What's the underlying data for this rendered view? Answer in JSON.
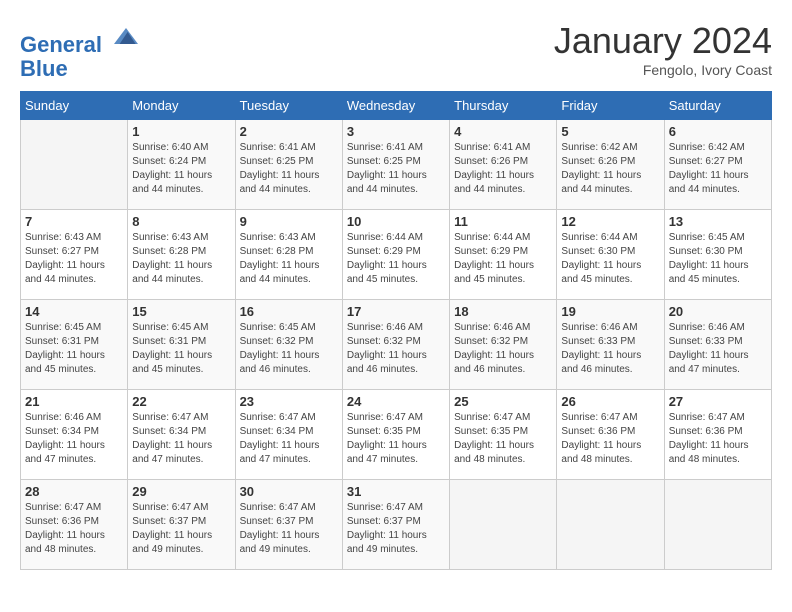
{
  "header": {
    "logo_line1": "General",
    "logo_line2": "Blue",
    "month": "January 2024",
    "location": "Fengolo, Ivory Coast"
  },
  "weekdays": [
    "Sunday",
    "Monday",
    "Tuesday",
    "Wednesday",
    "Thursday",
    "Friday",
    "Saturday"
  ],
  "weeks": [
    [
      {
        "day": "",
        "sunrise": "",
        "sunset": "",
        "daylight": ""
      },
      {
        "day": "1",
        "sunrise": "Sunrise: 6:40 AM",
        "sunset": "Sunset: 6:24 PM",
        "daylight": "Daylight: 11 hours and 44 minutes."
      },
      {
        "day": "2",
        "sunrise": "Sunrise: 6:41 AM",
        "sunset": "Sunset: 6:25 PM",
        "daylight": "Daylight: 11 hours and 44 minutes."
      },
      {
        "day": "3",
        "sunrise": "Sunrise: 6:41 AM",
        "sunset": "Sunset: 6:25 PM",
        "daylight": "Daylight: 11 hours and 44 minutes."
      },
      {
        "day": "4",
        "sunrise": "Sunrise: 6:41 AM",
        "sunset": "Sunset: 6:26 PM",
        "daylight": "Daylight: 11 hours and 44 minutes."
      },
      {
        "day": "5",
        "sunrise": "Sunrise: 6:42 AM",
        "sunset": "Sunset: 6:26 PM",
        "daylight": "Daylight: 11 hours and 44 minutes."
      },
      {
        "day": "6",
        "sunrise": "Sunrise: 6:42 AM",
        "sunset": "Sunset: 6:27 PM",
        "daylight": "Daylight: 11 hours and 44 minutes."
      }
    ],
    [
      {
        "day": "7",
        "sunrise": "Sunrise: 6:43 AM",
        "sunset": "Sunset: 6:27 PM",
        "daylight": "Daylight: 11 hours and 44 minutes."
      },
      {
        "day": "8",
        "sunrise": "Sunrise: 6:43 AM",
        "sunset": "Sunset: 6:28 PM",
        "daylight": "Daylight: 11 hours and 44 minutes."
      },
      {
        "day": "9",
        "sunrise": "Sunrise: 6:43 AM",
        "sunset": "Sunset: 6:28 PM",
        "daylight": "Daylight: 11 hours and 44 minutes."
      },
      {
        "day": "10",
        "sunrise": "Sunrise: 6:44 AM",
        "sunset": "Sunset: 6:29 PM",
        "daylight": "Daylight: 11 hours and 45 minutes."
      },
      {
        "day": "11",
        "sunrise": "Sunrise: 6:44 AM",
        "sunset": "Sunset: 6:29 PM",
        "daylight": "Daylight: 11 hours and 45 minutes."
      },
      {
        "day": "12",
        "sunrise": "Sunrise: 6:44 AM",
        "sunset": "Sunset: 6:30 PM",
        "daylight": "Daylight: 11 hours and 45 minutes."
      },
      {
        "day": "13",
        "sunrise": "Sunrise: 6:45 AM",
        "sunset": "Sunset: 6:30 PM",
        "daylight": "Daylight: 11 hours and 45 minutes."
      }
    ],
    [
      {
        "day": "14",
        "sunrise": "Sunrise: 6:45 AM",
        "sunset": "Sunset: 6:31 PM",
        "daylight": "Daylight: 11 hours and 45 minutes."
      },
      {
        "day": "15",
        "sunrise": "Sunrise: 6:45 AM",
        "sunset": "Sunset: 6:31 PM",
        "daylight": "Daylight: 11 hours and 45 minutes."
      },
      {
        "day": "16",
        "sunrise": "Sunrise: 6:45 AM",
        "sunset": "Sunset: 6:32 PM",
        "daylight": "Daylight: 11 hours and 46 minutes."
      },
      {
        "day": "17",
        "sunrise": "Sunrise: 6:46 AM",
        "sunset": "Sunset: 6:32 PM",
        "daylight": "Daylight: 11 hours and 46 minutes."
      },
      {
        "day": "18",
        "sunrise": "Sunrise: 6:46 AM",
        "sunset": "Sunset: 6:32 PM",
        "daylight": "Daylight: 11 hours and 46 minutes."
      },
      {
        "day": "19",
        "sunrise": "Sunrise: 6:46 AM",
        "sunset": "Sunset: 6:33 PM",
        "daylight": "Daylight: 11 hours and 46 minutes."
      },
      {
        "day": "20",
        "sunrise": "Sunrise: 6:46 AM",
        "sunset": "Sunset: 6:33 PM",
        "daylight": "Daylight: 11 hours and 47 minutes."
      }
    ],
    [
      {
        "day": "21",
        "sunrise": "Sunrise: 6:46 AM",
        "sunset": "Sunset: 6:34 PM",
        "daylight": "Daylight: 11 hours and 47 minutes."
      },
      {
        "day": "22",
        "sunrise": "Sunrise: 6:47 AM",
        "sunset": "Sunset: 6:34 PM",
        "daylight": "Daylight: 11 hours and 47 minutes."
      },
      {
        "day": "23",
        "sunrise": "Sunrise: 6:47 AM",
        "sunset": "Sunset: 6:34 PM",
        "daylight": "Daylight: 11 hours and 47 minutes."
      },
      {
        "day": "24",
        "sunrise": "Sunrise: 6:47 AM",
        "sunset": "Sunset: 6:35 PM",
        "daylight": "Daylight: 11 hours and 47 minutes."
      },
      {
        "day": "25",
        "sunrise": "Sunrise: 6:47 AM",
        "sunset": "Sunset: 6:35 PM",
        "daylight": "Daylight: 11 hours and 48 minutes."
      },
      {
        "day": "26",
        "sunrise": "Sunrise: 6:47 AM",
        "sunset": "Sunset: 6:36 PM",
        "daylight": "Daylight: 11 hours and 48 minutes."
      },
      {
        "day": "27",
        "sunrise": "Sunrise: 6:47 AM",
        "sunset": "Sunset: 6:36 PM",
        "daylight": "Daylight: 11 hours and 48 minutes."
      }
    ],
    [
      {
        "day": "28",
        "sunrise": "Sunrise: 6:47 AM",
        "sunset": "Sunset: 6:36 PM",
        "daylight": "Daylight: 11 hours and 48 minutes."
      },
      {
        "day": "29",
        "sunrise": "Sunrise: 6:47 AM",
        "sunset": "Sunset: 6:37 PM",
        "daylight": "Daylight: 11 hours and 49 minutes."
      },
      {
        "day": "30",
        "sunrise": "Sunrise: 6:47 AM",
        "sunset": "Sunset: 6:37 PM",
        "daylight": "Daylight: 11 hours and 49 minutes."
      },
      {
        "day": "31",
        "sunrise": "Sunrise: 6:47 AM",
        "sunset": "Sunset: 6:37 PM",
        "daylight": "Daylight: 11 hours and 49 minutes."
      },
      {
        "day": "",
        "sunrise": "",
        "sunset": "",
        "daylight": ""
      },
      {
        "day": "",
        "sunrise": "",
        "sunset": "",
        "daylight": ""
      },
      {
        "day": "",
        "sunrise": "",
        "sunset": "",
        "daylight": ""
      }
    ]
  ]
}
